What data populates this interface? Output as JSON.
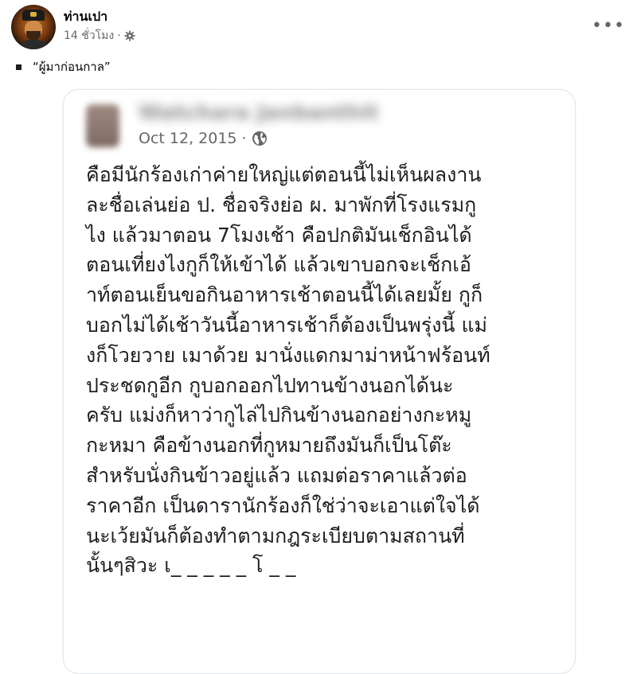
{
  "post": {
    "author": "ท่านเปา",
    "time": "14 ชั่วโมง",
    "meta_separator": "·",
    "caption": "“ผู้มาก่อนกาล”",
    "more_label": "•••"
  },
  "shared_screenshot": {
    "author_blurred": "Watchara Janbanthit",
    "date": "Oct 12, 2015",
    "date_separator": "·",
    "lines": [
      "คือมีนักร้องเก่าค่ายใหญ่แต่ตอนนี้ไม่เห็นผลงาน",
      "ละชื่อเล่นย่อ ป. ชื่อจริงย่อ ผ. มาพักที่โรงแรมกู",
      "ไง แล้วมาตอน 7โมงเช้า คือปกติมันเช็กอินได้",
      "ตอนเที่ยงไงกูก็ให้เข้าได้ แล้วเขาบอกจะเช็กเอ้",
      "าท์ตอนเย็นขอกินอาหารเช้าตอนนี้ได้เลยมั้ย กูก็",
      "บอกไม่ได้เช้าวันนี้อาหารเช้าก็ต้องเป็นพรุ่งนี้ แม่",
      "งก็โวยวาย เมาด้วย มานั่งแดกมาม่าหน้าฟร้อนท์",
      "ประชดกูอีก กูบอกออกไปทานข้างนอกได้นะ",
      "ครับ แม่งก็หาว่ากูไล่ไปกินข้างนอกอย่างกะหมู",
      "กะหมา คือข้างนอกที่กูหมายถึงมันก็เป็นโต๊ะ",
      "สำหรับนั่งกินข้าวอยู่แล้ว แถมต่อราคาแล้วต่อ",
      "ราคาอีก เป็นดารานักร้องก็ใช่ว่าจะเอาแต่ใจได้",
      "นะเว้ยมันก็ต้องทำตามกฎระเบียบตามสถานที่",
      "นั้นๆสิวะ เ_ _ _ _ _ โ _ _"
    ]
  },
  "colors": {
    "meta": "#65676b",
    "text": "#050505",
    "card_border": "#e4e6eb"
  },
  "icons": {
    "audience": "gear-icon",
    "inner_audience": "globe-icon",
    "bullet": "square-bullet-icon"
  }
}
